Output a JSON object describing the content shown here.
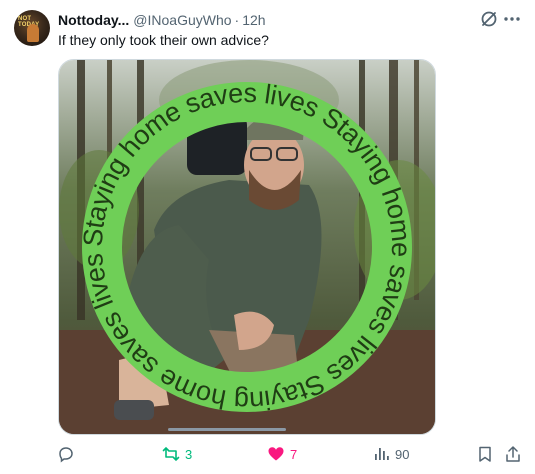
{
  "tweet": {
    "display_name": "Nottoday...",
    "handle": "@INoaGuyWho",
    "separator": "·",
    "time": "12h",
    "text": "If they only took their own advice?",
    "avatar_text": "NOT TODAY"
  },
  "media": {
    "frame_text": "Staying home saves lives Staying home saves lives Staying home saves lives",
    "ring_color": "#6fcf57",
    "text_color": "#1f3d14"
  },
  "actions": {
    "reply_count": "",
    "repost_count": "3",
    "like_count": "7",
    "views_count": "90"
  },
  "colors": {
    "repost": "#00ba7c",
    "like": "#f91880",
    "muted": "#536471"
  },
  "icons": [
    "grok-icon",
    "more-icon",
    "reply-icon",
    "repost-icon",
    "heart-icon",
    "views-icon",
    "bookmark-icon",
    "share-icon"
  ]
}
